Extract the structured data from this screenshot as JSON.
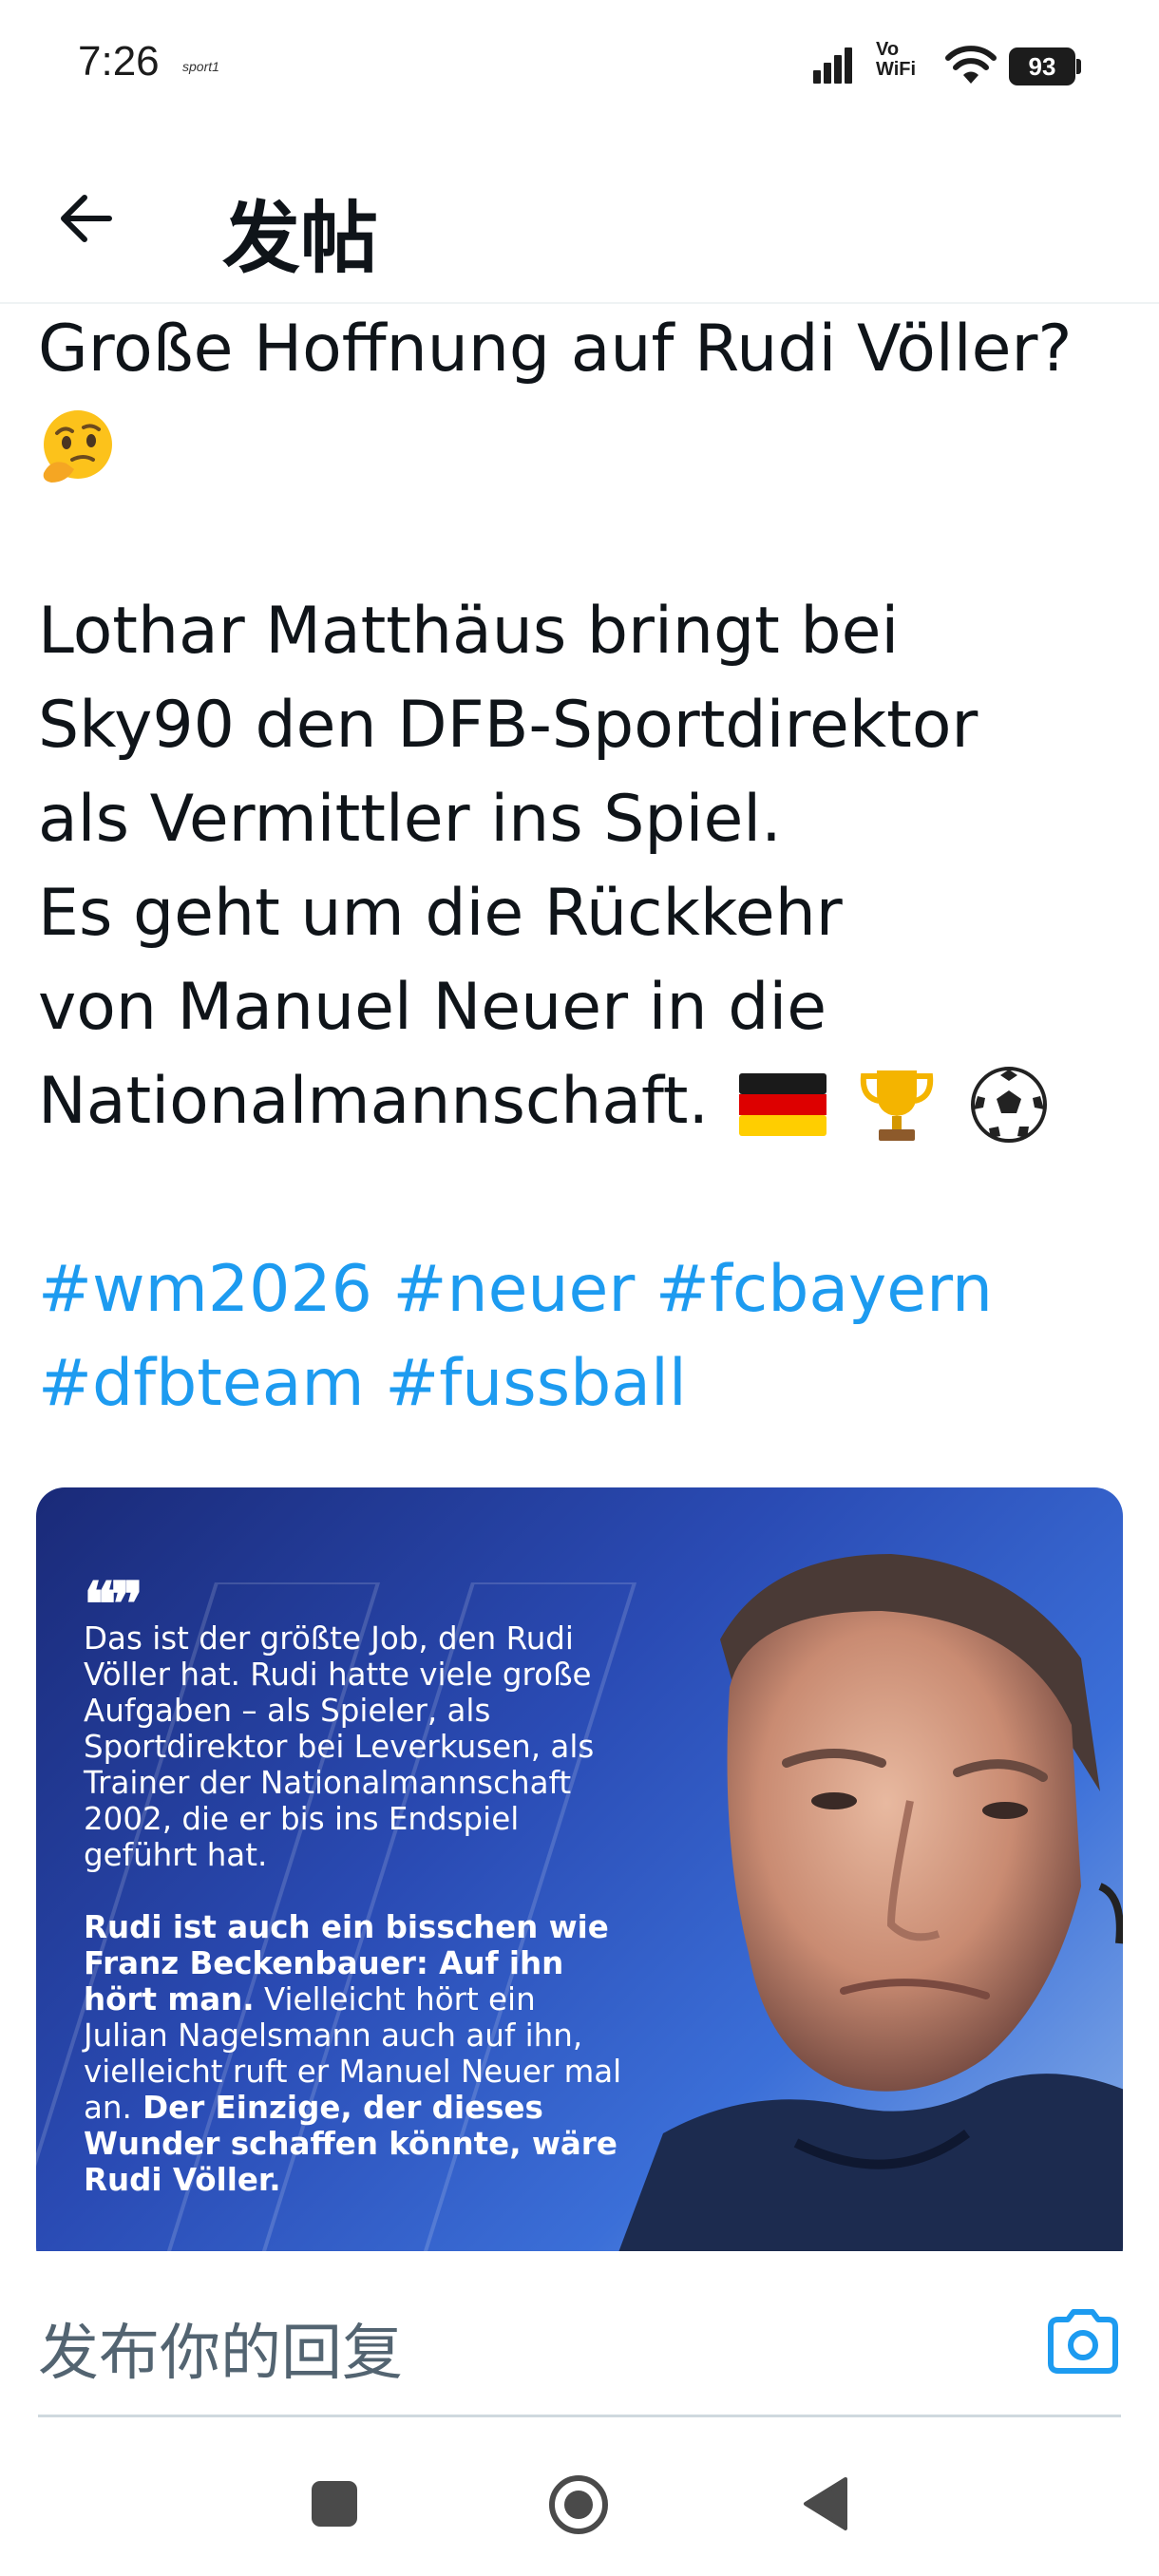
{
  "status_bar": {
    "time": "7:26",
    "app_label": "sport1",
    "network": "Vo WiFi",
    "battery": "93"
  },
  "header": {
    "back_icon": "arrow-left-icon",
    "title": "发帖"
  },
  "post": {
    "lines": [
      "Große Hoffnung auf Rudi Völler?",
      "Lothar Matthäus bringt bei",
      "Sky90 den DFB-Sportdirektor",
      "als Vermittler ins Spiel.",
      "Es geht um die Rückkehr",
      "von Manuel Neuer in die",
      "Nationalmannschaft."
    ],
    "emojis": {
      "thinking": "🤔",
      "flag": "🇩🇪",
      "trophy": "🏆",
      "ball": "⚽"
    },
    "hashtag_lines": [
      "#wm2026 #neuer #fcbayern",
      "#dfbteam #fussball"
    ]
  },
  "media": {
    "quote_marks": "❝❞",
    "para1": "Das ist der größte Job, den Rudi Völler hat. Rudi hatte viele große Aufgaben – als Spieler, als Sportdirektor bei Leverkusen, als Trainer der Nationalmannschaft 2002, die er bis ins Endspiel geführt hat.",
    "para2_bold1": "Rudi ist auch ein bisschen wie Franz Beckenbauer: Auf ihn hört man.",
    "para2_normal": " Vielleicht hört ein Julian Nagelsmann auch auf ihn, vielleicht ruft er Manuel Neuer mal an.",
    "para2_bold2": " Der Einzige, der dieses Wunder schaffen könnte, wäre Rudi Völler."
  },
  "reply": {
    "placeholder": "发布你的回复",
    "camera_icon": "camera-icon",
    "accent": "#1d9bf0"
  },
  "nav": {
    "recent_icon": "square-icon",
    "home_icon": "circle-icon",
    "back_icon": "triangle-back-icon"
  }
}
